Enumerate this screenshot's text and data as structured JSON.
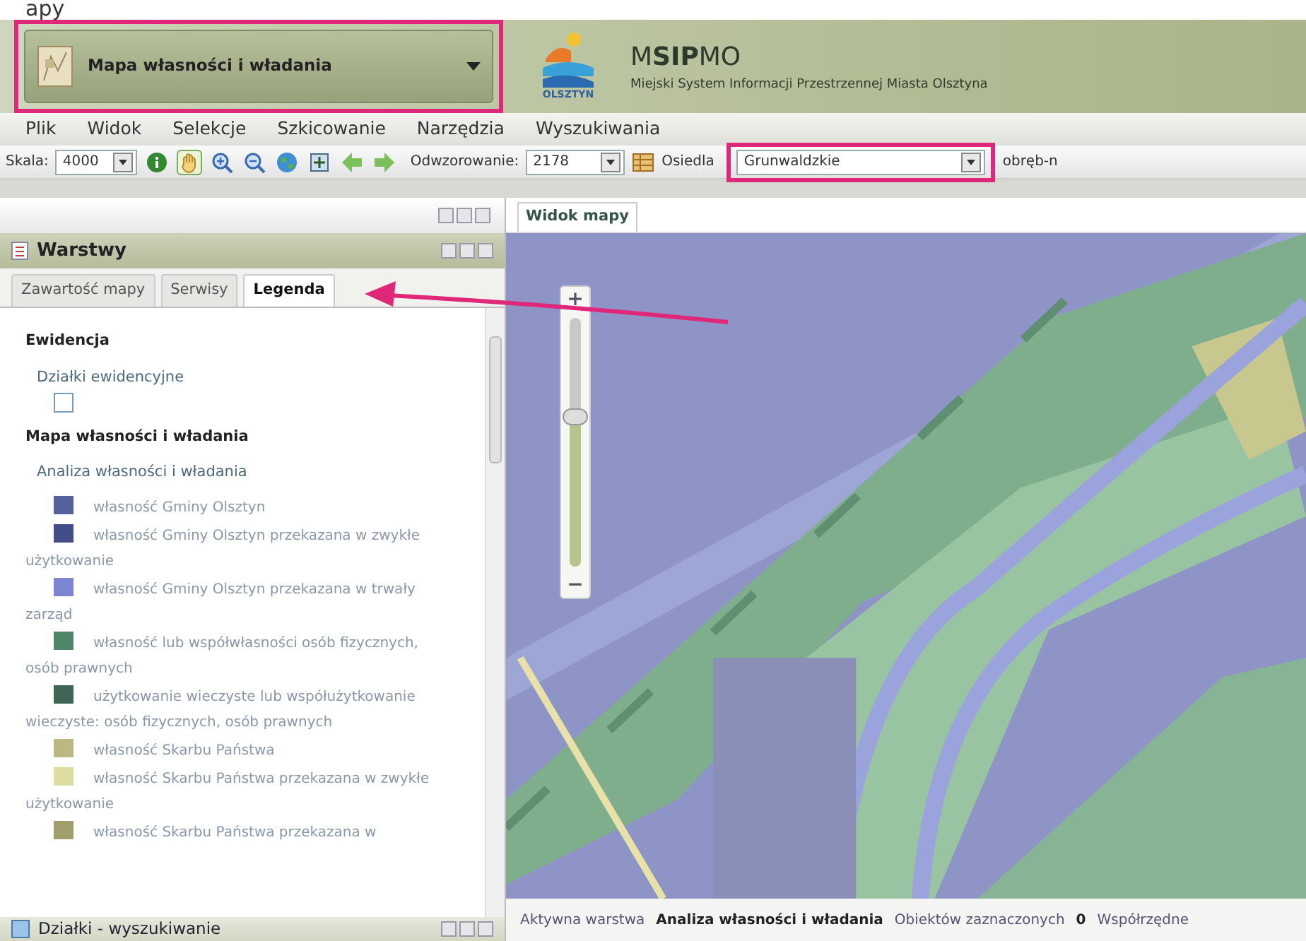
{
  "document_fragment": "apy",
  "header": {
    "layer_selector": "Mapa własności i władania",
    "logo_caption": "OLSZTYN",
    "title": "M**SIP**MO",
    "subtitle": "Miejski System Informacji Przestrzennej Miasta Olsztyna"
  },
  "menu": [
    "Plik",
    "Widok",
    "Selekcje",
    "Szkicowanie",
    "Narzędzia",
    "Wyszukiwania"
  ],
  "toolbar": {
    "scale_label": "Skala:",
    "scale_value": "4000",
    "tools": [
      {
        "kind": "info",
        "selected": false
      },
      {
        "kind": "pan",
        "selected": true
      },
      {
        "kind": "zoom-in",
        "selected": false
      },
      {
        "kind": "zoom-out",
        "selected": false
      },
      {
        "kind": "globe",
        "selected": false
      },
      {
        "kind": "extent",
        "selected": false
      },
      {
        "kind": "back",
        "selected": false
      },
      {
        "kind": "forward",
        "selected": false
      }
    ],
    "projection_label": "Odwzorowanie:",
    "projection_value": "2178",
    "district_label": "Osiedla",
    "district_value": "Grunwaldzkie",
    "next_label": "obręb-n"
  },
  "layers_panel": {
    "title": "Warstwy",
    "tabs": [
      {
        "label": "Zawartość mapy",
        "selected": false
      },
      {
        "label": "Serwisy",
        "selected": false
      },
      {
        "label": "Legenda",
        "selected": true
      }
    ],
    "legend": [
      {
        "heading": "Ewidencja",
        "layers": [
          {
            "name": "Działki ewidencyjne",
            "items": [
              {
                "kind": "outline",
                "color": "#7a9cbc"
              }
            ]
          }
        ]
      },
      {
        "heading": "Mapa własności i władania",
        "layers": [
          {
            "name": "Analiza własności i władania",
            "items": [
              {
                "kind": "fill",
                "color": "#56609e",
                "label": "własność Gminy Olsztyn"
              },
              {
                "kind": "fill",
                "color": "#434d8c",
                "label": "własność Gminy Olsztyn przekazana w zwykłe użytkowanie"
              },
              {
                "kind": "fill",
                "color": "#7c85cf",
                "label": "własność Gminy Olsztyn przekazana w trwały zarząd"
              },
              {
                "kind": "fill",
                "color": "#4f8868",
                "label": "własność lub współwłasności osób fizycznych, osób prawnych"
              },
              {
                "kind": "fill",
                "color": "#3e6654",
                "label": "użytkowanie wieczyste lub współużytkowanie wieczyste: osób fizycznych, osób prawnych"
              },
              {
                "kind": "fill",
                "color": "#bcb884",
                "label": "własność Skarbu Państwa"
              },
              {
                "kind": "fill",
                "color": "#dedda0",
                "label": "własność Skarbu Państwa przekazana w zwykłe użytkowanie"
              },
              {
                "kind": "fill",
                "color": "#a09e6c",
                "label": "własność Skarbu Państwa przekazana w"
              }
            ]
          }
        ]
      }
    ]
  },
  "search_panel": {
    "title": "Działki - wyszukiwanie"
  },
  "map": {
    "tab": "Widok mapy",
    "zoom_slider": {
      "plus": "+",
      "minus": "−",
      "level": 0.6
    },
    "status": [
      {
        "label": "Aktywna warstwa",
        "value": "Analiza własności i władania"
      },
      {
        "label": "Obiektów zaznaczonych",
        "value": "0"
      },
      {
        "label": "Współrzędne"
      }
    ]
  }
}
